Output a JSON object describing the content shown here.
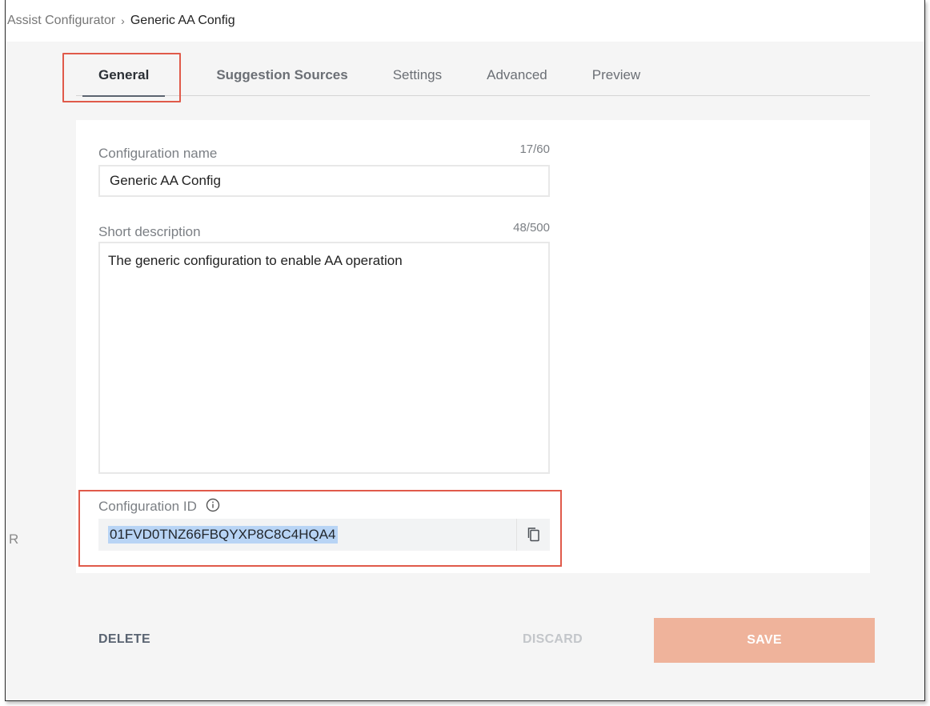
{
  "breadcrumb": {
    "parent": "Assist Configurator",
    "separator": "›",
    "current": "Generic AA Config"
  },
  "tabs": [
    {
      "label": "General",
      "active": true
    },
    {
      "label": "Suggestion Sources",
      "active": false
    },
    {
      "label": "Settings",
      "active": false
    },
    {
      "label": "Advanced",
      "active": false
    },
    {
      "label": "Preview",
      "active": false
    }
  ],
  "form": {
    "config_name": {
      "label": "Configuration name",
      "counter": "17/60",
      "value": "Generic AA Config"
    },
    "short_description": {
      "label": "Short description",
      "counter": "48/500",
      "value": "The generic configuration to enable AA operation"
    },
    "config_id": {
      "label": "Configuration ID",
      "value": "01FVD0TNZ66FBQYXP8C8C4HQA4",
      "info_icon": "info-icon",
      "copy_icon": "copy-icon"
    }
  },
  "side_label": "R",
  "footer": {
    "delete_label": "DELETE",
    "discard_label": "DISCARD",
    "save_label": "SAVE"
  },
  "colors": {
    "highlight": "#e05a4a",
    "save_button": "#efb39b",
    "selection": "#b8d4f5"
  }
}
